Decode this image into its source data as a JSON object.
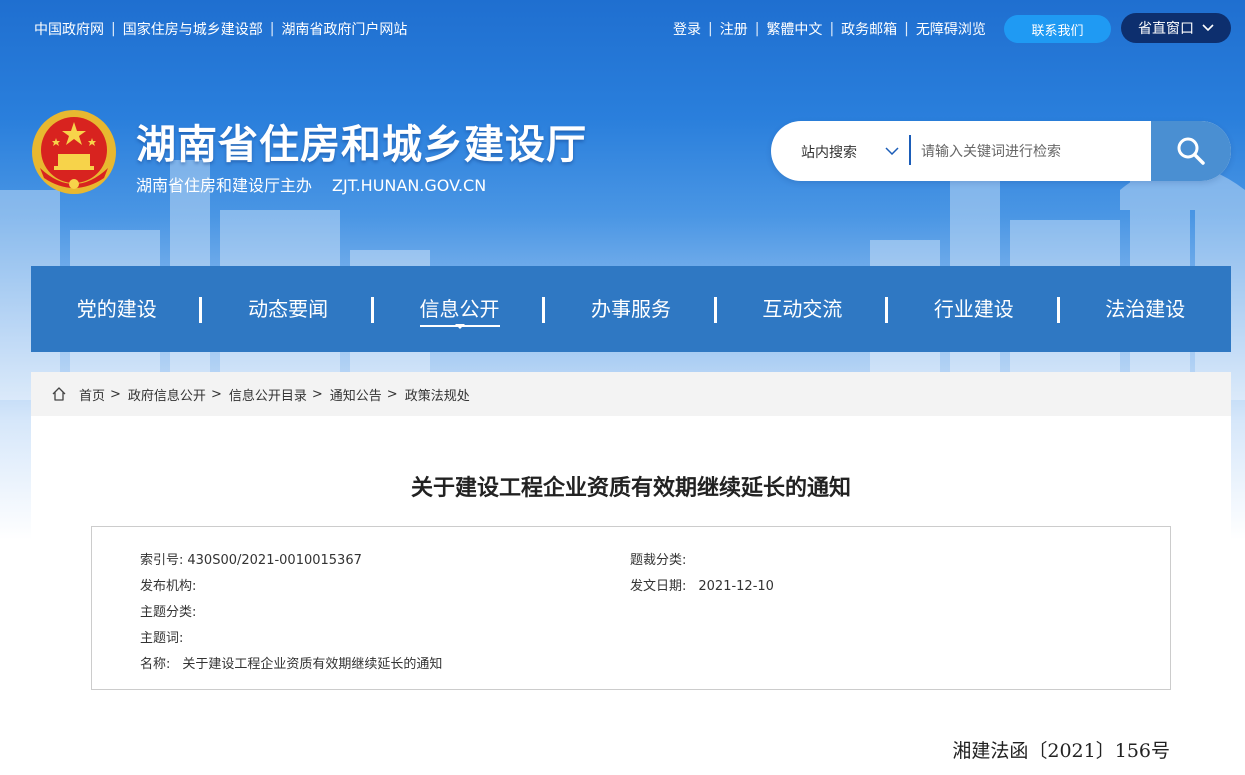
{
  "top_links_left": [
    "中国政府网",
    "国家住房与城乡建设部",
    "湖南省政府门户网站"
  ],
  "top_links_right": [
    "登录",
    "注册",
    "繁體中文",
    "政务邮箱",
    "无障碍浏览"
  ],
  "contact_button": "联系我们",
  "window_button": "省直窗口",
  "site": {
    "title": "湖南省住房和城乡建设厅",
    "subtitle": "湖南省住房和建设厅主办",
    "domain": "ZJT.HUNAN.GOV.CN"
  },
  "search": {
    "scope": "站内搜索",
    "placeholder": "请输入关键词进行检索"
  },
  "nav": [
    "党的建设",
    "动态要闻",
    "信息公开",
    "办事服务",
    "互动交流",
    "行业建设",
    "法治建设"
  ],
  "nav_active": "信息公开",
  "breadcrumb": [
    "首页",
    "政府信息公开",
    "信息公开目录",
    "通知公告",
    "政策法规处"
  ],
  "article": {
    "title": "关于建设工程企业资质有效期继续延长的通知",
    "meta": {
      "index_label": "索引号:",
      "index_value": "430S00/2021-0010015367",
      "genre_label": "题裁分类:",
      "genre_value": "",
      "publisher_label": "发布机构:",
      "publisher_value": "",
      "date_label": "发文日期:",
      "date_value": "2021-12-10",
      "topic_label": "主题分类:",
      "topic_value": "",
      "keywords_label": "主题词:",
      "keywords_value": "",
      "name_label": "名称:",
      "name_value": "关于建设工程企业资质有效期继续延长的通知"
    },
    "doc_number": "湘建法函〔2021〕156号"
  }
}
